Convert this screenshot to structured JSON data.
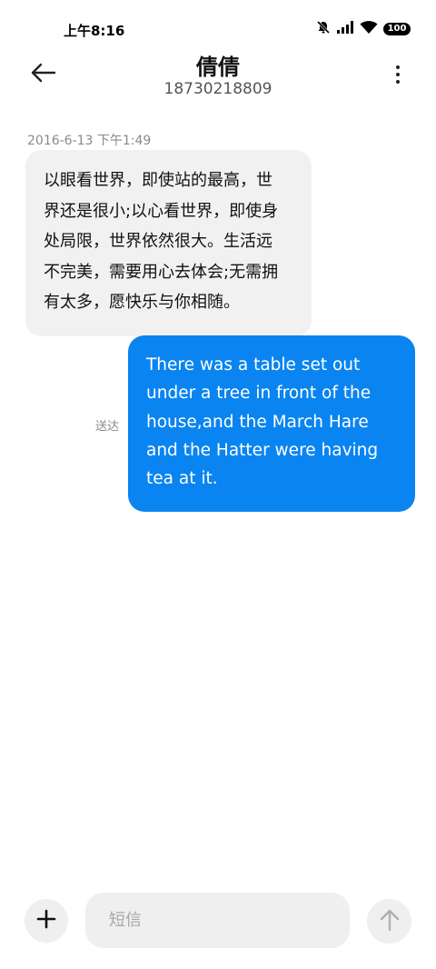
{
  "status_bar": {
    "time": "上午8:16",
    "battery": "100",
    "icons": [
      "mute-icon",
      "signal-icon",
      "wifi-icon",
      "battery-icon"
    ]
  },
  "header": {
    "contact_name": "倩倩",
    "contact_number": "18730218809",
    "back_icon": "arrow-left-icon",
    "more_icon": "more-vertical-icon"
  },
  "conversation": {
    "timestamp": "2016-6-13 下午1:49",
    "messages": [
      {
        "direction": "incoming",
        "lines": [
          "以眼看世界，即使站的最高，世",
          "界还是很小;以心看世界，即使身",
          "处局限，世界依然很大。生活远",
          "不完美，需要用心去体会;无需拥",
          "有太多，愿快乐与你相随。"
        ]
      },
      {
        "direction": "outgoing",
        "status": "送达",
        "lines": [
          "There was a table set out",
          "under a tree in front of the",
          "house,and the March Hare",
          "and the Hatter were having",
          "tea at it."
        ]
      }
    ]
  },
  "composer": {
    "placeholder": "短信",
    "add_icon": "plus-icon",
    "send_icon": "arrow-up-icon"
  },
  "colors": {
    "outgoing_bubble": "#0a84f0",
    "incoming_bubble": "#f1f1f1",
    "secondary_text": "#8a8a8a"
  }
}
